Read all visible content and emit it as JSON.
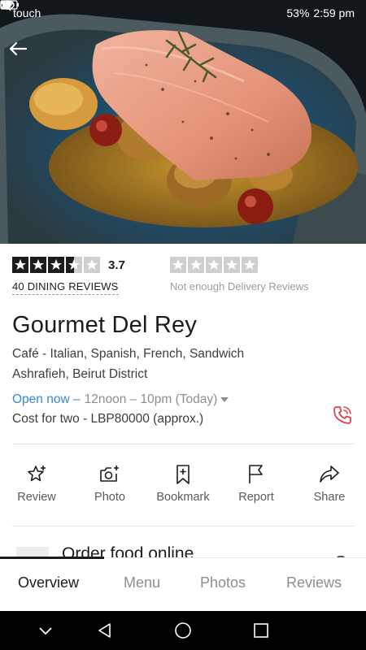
{
  "status_bar": {
    "carrier": "touch",
    "battery": "53%",
    "time": "2:59 pm"
  },
  "restaurant": {
    "name": "Gourmet Del Rey",
    "cuisines": "Café - Italian, Spanish, French, Sandwich",
    "locality": "Ashrafieh, Beirut District",
    "open_status": "Open now –",
    "hours": "12noon – 10pm (Today)",
    "cost": "Cost for two - LBP80000 (approx.)"
  },
  "dining_rating": {
    "value": "3.7",
    "stars_filled": 3.5,
    "stars_total": 5,
    "reviews_count": "40",
    "reviews_label": "DINING REVIEWS"
  },
  "delivery_rating": {
    "stars_total": 5,
    "note": "Not enough Delivery Reviews"
  },
  "actions": [
    {
      "label": "Review",
      "icon": "star-plus-icon"
    },
    {
      "label": "Photo",
      "icon": "camera-plus-icon"
    },
    {
      "label": "Bookmark",
      "icon": "bookmark-plus-icon"
    },
    {
      "label": "Report",
      "icon": "flag-icon"
    },
    {
      "label": "Share",
      "icon": "share-arrow-icon"
    }
  ],
  "order_section": {
    "label": "Order food online"
  },
  "tabs": [
    {
      "label": "Overview",
      "active": true
    },
    {
      "label": "Menu",
      "active": false
    },
    {
      "label": "Photos",
      "active": false
    },
    {
      "label": "Reviews",
      "active": false
    }
  ],
  "colors": {
    "accent_blue": "#3a86d8",
    "call_red": "#e0424f",
    "star_dark": "#1c1c1c",
    "star_empty": "#cfcfcf"
  }
}
